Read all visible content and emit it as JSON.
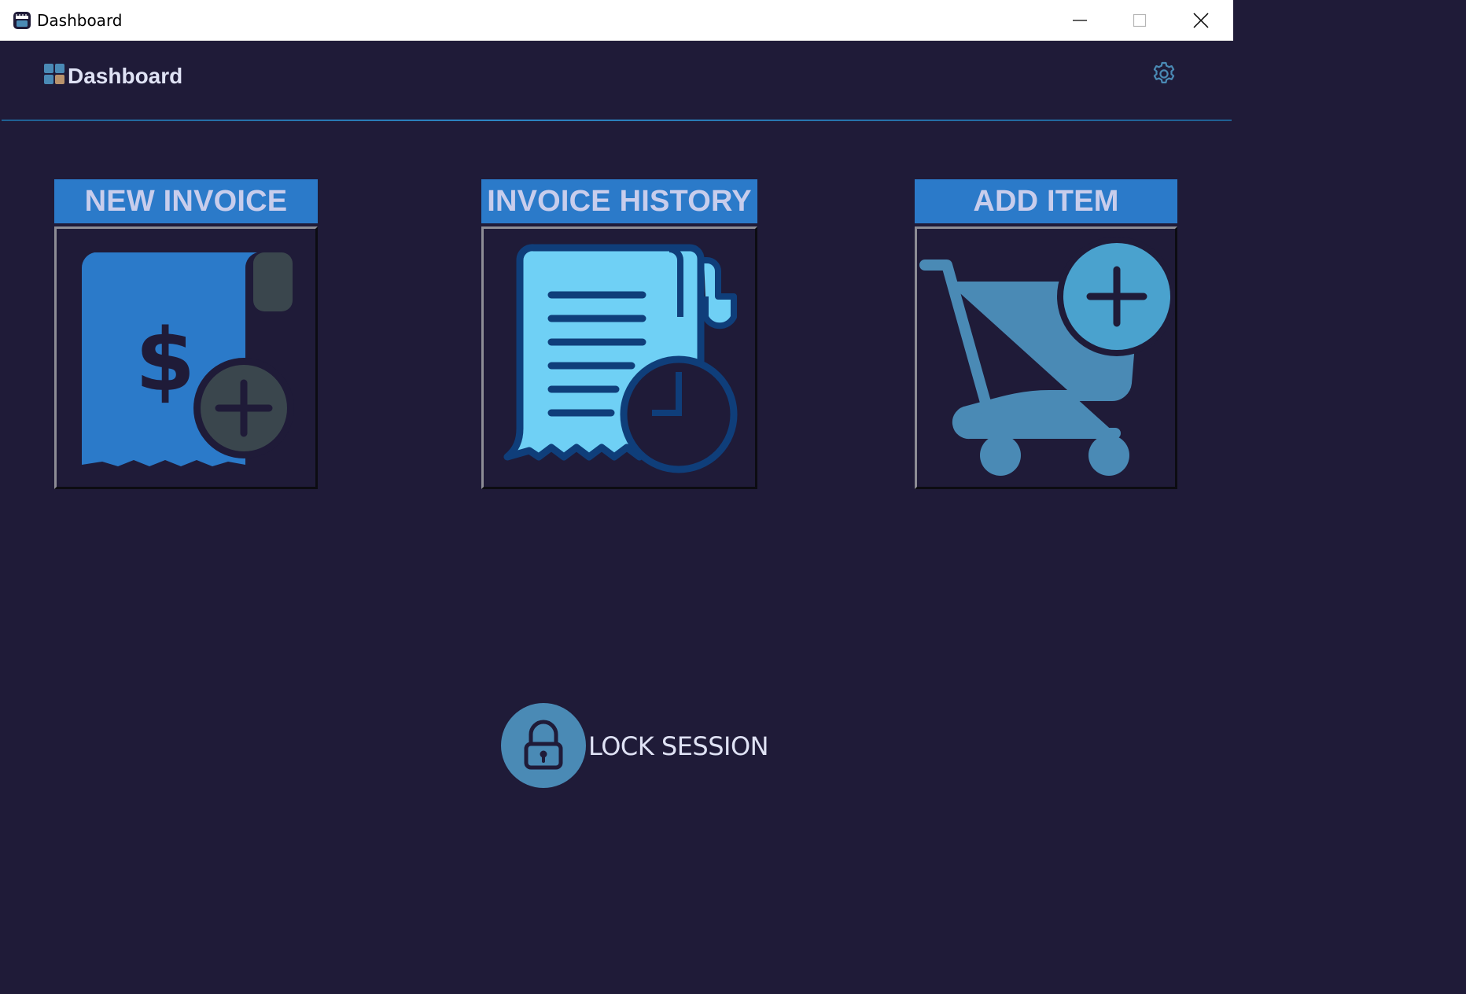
{
  "window": {
    "title": "Dashboard",
    "controls": [
      "minimize",
      "maximize",
      "close"
    ]
  },
  "header": {
    "title": "Dashboard",
    "logo_icon": "grid-squares-icon",
    "settings_icon": "gear-icon"
  },
  "tiles": [
    {
      "label": "NEW INVOICE",
      "icon": "receipt-dollar-plus-icon"
    },
    {
      "label": "INVOICE HISTORY",
      "icon": "receipt-clock-icon"
    },
    {
      "label": "ADD ITEM",
      "icon": "cart-plus-icon"
    }
  ],
  "lock": {
    "label": "LOCK SESSION",
    "icon": "padlock-icon"
  },
  "colors": {
    "background": "#1f1b38",
    "tile_label_bg": "#2b7ac9",
    "accent": "#4a8ab5",
    "text": "#dfe2f4"
  }
}
